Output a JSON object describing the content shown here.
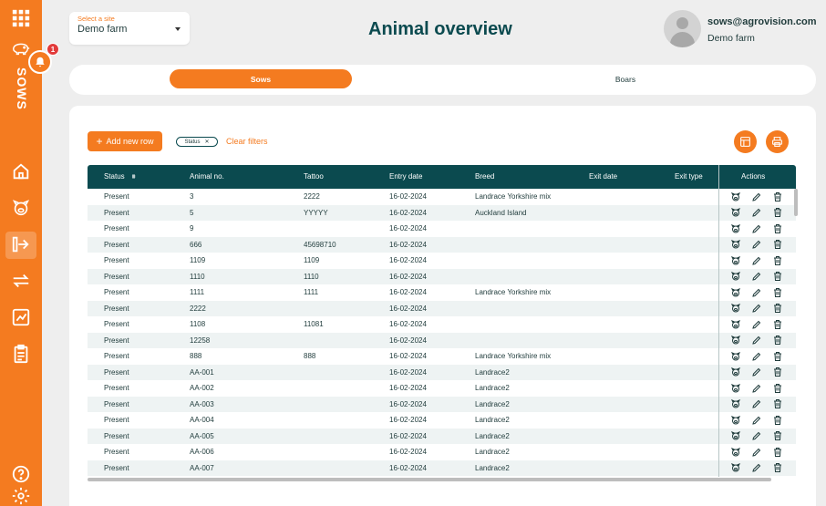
{
  "sidebar": {
    "module_label": "SOWS",
    "notification_count": "1"
  },
  "header": {
    "site_select_label": "Select a site",
    "site_value": "Demo farm",
    "title": "Animal overview",
    "user_email": "sows@agrovision.com",
    "user_farm": "Demo farm"
  },
  "tabs": [
    {
      "label": "Sows",
      "active": true
    },
    {
      "label": "Boars",
      "active": false
    }
  ],
  "toolbar": {
    "add_row_label": "Add new row",
    "filter_chip": "Status",
    "clear_filters": "Clear filters"
  },
  "table": {
    "columns": [
      "Status",
      "Animal no.",
      "Tattoo",
      "Entry date",
      "Breed",
      "Exit date",
      "Exit type",
      "Actions"
    ],
    "rows": [
      [
        "Present",
        "3",
        "2222",
        "16-02-2024",
        "Landrace Yorkshire mix",
        "",
        ""
      ],
      [
        "Present",
        "5",
        "YYYYY",
        "16-02-2024",
        "Auckland Island",
        "",
        ""
      ],
      [
        "Present",
        "9",
        "",
        "16-02-2024",
        "",
        "",
        ""
      ],
      [
        "Present",
        "666",
        "45698710",
        "16-02-2024",
        "",
        "",
        ""
      ],
      [
        "Present",
        "1109",
        "1109",
        "16-02-2024",
        "",
        "",
        ""
      ],
      [
        "Present",
        "1110",
        "1110",
        "16-02-2024",
        "",
        "",
        ""
      ],
      [
        "Present",
        "1111",
        "1111",
        "16-02-2024",
        "Landrace Yorkshire mix",
        "",
        ""
      ],
      [
        "Present",
        "2222",
        "",
        "16-02-2024",
        "",
        "",
        ""
      ],
      [
        "Present",
        "1108",
        "11081",
        "16-02-2024",
        "",
        "",
        ""
      ],
      [
        "Present",
        "12258",
        "",
        "16-02-2024",
        "",
        "",
        ""
      ],
      [
        "Present",
        "888",
        "888",
        "16-02-2024",
        "Landrace Yorkshire mix",
        "",
        ""
      ],
      [
        "Present",
        "AA-001",
        "",
        "16-02-2024",
        "Landrace2",
        "",
        ""
      ],
      [
        "Present",
        "AA-002",
        "",
        "16-02-2024",
        "Landrace2",
        "",
        ""
      ],
      [
        "Present",
        "AA-003",
        "",
        "16-02-2024",
        "Landrace2",
        "",
        ""
      ],
      [
        "Present",
        "AA-004",
        "",
        "16-02-2024",
        "Landrace2",
        "",
        ""
      ],
      [
        "Present",
        "AA-005",
        "",
        "16-02-2024",
        "Landrace2",
        "",
        ""
      ],
      [
        "Present",
        "AA-006",
        "",
        "16-02-2024",
        "Landrace2",
        "",
        ""
      ],
      [
        "Present",
        "AA-007",
        "",
        "16-02-2024",
        "Landrace2",
        "",
        ""
      ]
    ]
  },
  "colors": {
    "accent": "#f47b20",
    "header_teal": "#0b4a4f",
    "badge_red": "#e23b3b"
  }
}
